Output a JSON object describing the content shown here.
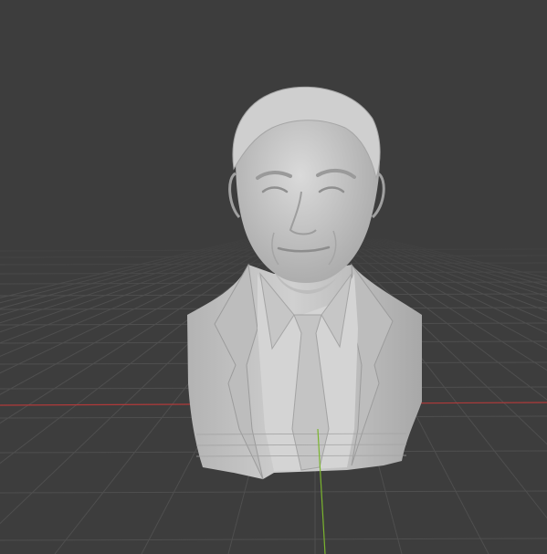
{
  "viewport": {
    "background_color": "#3d3d3d",
    "grid_color": "#4f4f4f",
    "x_axis_color": "#b03a3a",
    "y_axis_color": "#7bb52e",
    "mesh_color": "#c9c9c9",
    "mesh_shadow_color": "#9a9a9a",
    "mesh_highlight_color": "#e2e2e2"
  },
  "scene": {
    "object": "bust-sculpture",
    "show_grid_floor": true,
    "show_x_axis": true,
    "show_y_axis": true
  }
}
